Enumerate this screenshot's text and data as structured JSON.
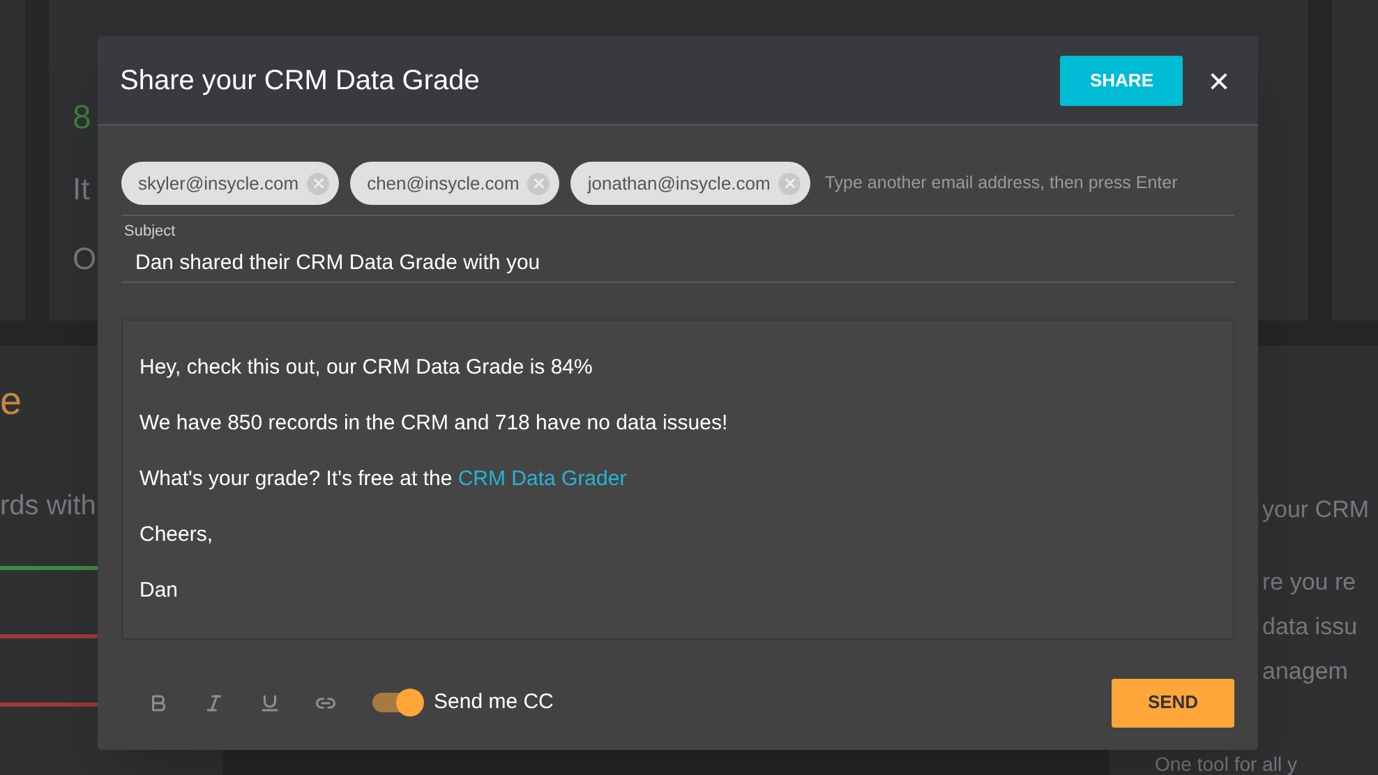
{
  "background": {
    "score": "8",
    "lines": [
      "It",
      "O"
    ],
    "section_title": "e",
    "subtitle": "rds with",
    "bars": [
      {
        "color": "#3f8a40"
      },
      {
        "color": "#9c3a3a"
      },
      {
        "color": "#9c3a3a"
      }
    ],
    "side_title": "your CRM",
    "side_lines": [
      "re you re",
      "data issu",
      "anagem"
    ],
    "side_footer": "One tool for all y"
  },
  "dialog": {
    "title": "Share your CRM Data Grade",
    "share_button": "SHARE",
    "close": "×",
    "recipients": [
      "skyler@insycle.com",
      "chen@insycle.com",
      "jonathan@insycle.com"
    ],
    "recipient_placeholder": "Type another email address, then press Enter",
    "subject": {
      "label": "Subject",
      "value": "Dan shared their CRM Data Grade with you"
    },
    "body": [
      {
        "text": "Hey, check this out, our CRM Data Grade is 84%"
      },
      {
        "text": "We have 850 records in the CRM and 718 have no data issues!"
      },
      {
        "text": "What's your grade? It's free at the ",
        "link": "CRM Data Grader"
      },
      {
        "text": "Cheers,"
      },
      {
        "text": "Dan"
      }
    ],
    "format_tools": [
      {
        "kind": "bold"
      },
      {
        "kind": "italic"
      },
      {
        "kind": "underline"
      },
      {
        "kind": "link"
      }
    ],
    "send_cc": {
      "label": "Send me CC",
      "on": true
    },
    "send_button": "SEND"
  }
}
